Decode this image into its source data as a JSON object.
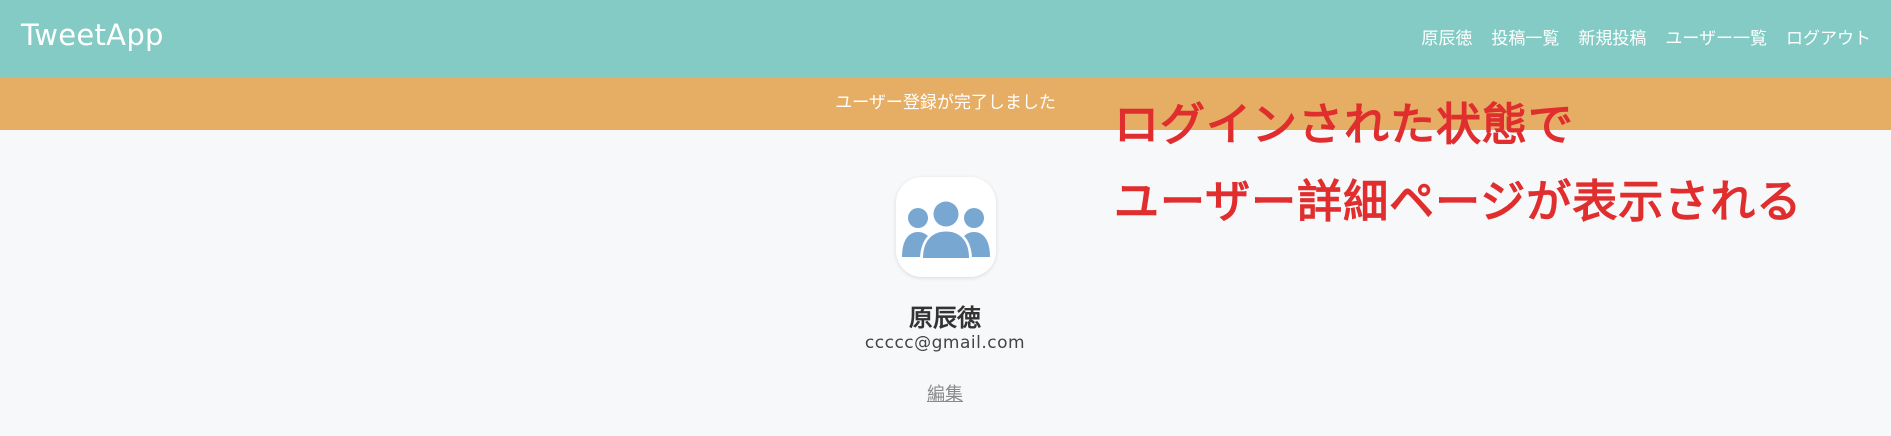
{
  "header": {
    "logo": "TweetApp",
    "nav": [
      "原辰徳",
      "投稿一覧",
      "新規投稿",
      "ユーザー一覧",
      "ログアウト"
    ]
  },
  "flash": {
    "message": "ユーザー登録が完了しました"
  },
  "profile": {
    "avatar_icon": "users-group-icon",
    "name": "原辰徳",
    "email": "ccccc@gmail.com",
    "edit_label": "編集"
  },
  "annotation": {
    "line1": "ログインされた状態で",
    "line2": "ユーザー詳細ページが表示される"
  },
  "colors": {
    "header": "#83cbc4",
    "flash": "#e5ae64",
    "annotation": "#e02e2e",
    "avatar_icon": "#78a8d2"
  }
}
